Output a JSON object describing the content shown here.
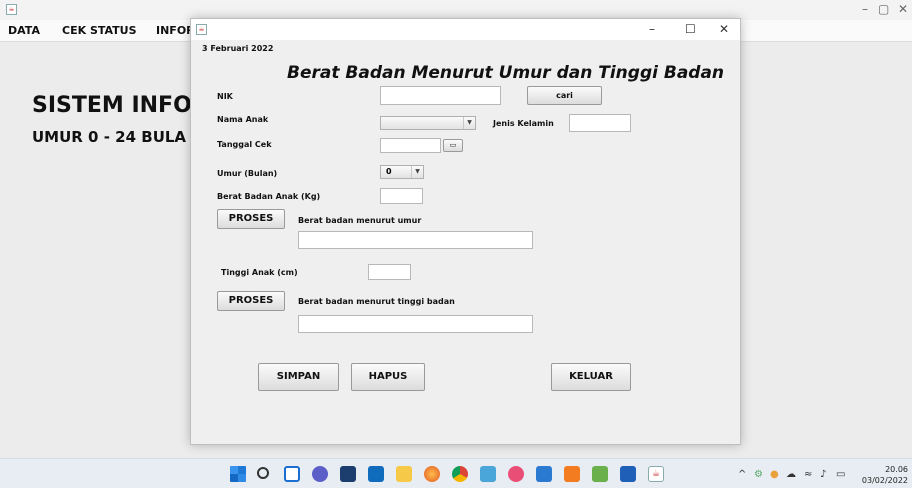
{
  "background_app": {
    "menu": [
      "DATA",
      "CEK STATUS",
      "INFOR"
    ],
    "title_line1": "SISTEM INFO",
    "title_line2": "UMUR 0 - 24 BULA",
    "window_controls": {
      "minimize": "–",
      "maximize": "▢",
      "close": "✕"
    }
  },
  "dialog": {
    "window_controls": {
      "minimize": "–",
      "maximize": "☐",
      "close": "✕"
    },
    "date": "3 Februari 2022",
    "heading": "Berat Badan Menurut Umur dan Tinggi Badan",
    "fields": {
      "nik_label": "NIK",
      "nik_value": "",
      "cari_button": "cari",
      "nama_anak_label": "Nama Anak",
      "nama_anak_value": "",
      "jenis_kelamin_label": "Jenis Kelamin",
      "jenis_kelamin_value": "",
      "tanggal_cek_label": "Tanggal Cek",
      "tanggal_cek_value": "",
      "umur_label": "Umur (Bulan)",
      "umur_value": "0",
      "berat_label": "Berat Badan Anak (Kg)",
      "berat_value": "",
      "proses1_button": "PROSES",
      "bb_umur_label": "Berat badan menurut umur",
      "bb_umur_value": "",
      "tinggi_label": "Tinggi Anak (cm)",
      "tinggi_value": "",
      "proses2_button": "PROSES",
      "bb_tinggi_label": "Berat badan menurut tinggi badan",
      "bb_tinggi_value": ""
    },
    "buttons": {
      "simpan": "SIMPAN",
      "hapus": "HAPUS",
      "keluar": "KELUAR"
    }
  },
  "taskbar": {
    "icons": [
      "windows-start-icon",
      "search-icon",
      "task-view-icon",
      "chat-icon",
      "calculator-icon",
      "mail-icon",
      "file-explorer-icon",
      "firefox-icon",
      "chrome-icon",
      "network-app-icon",
      "notification-app-icon",
      "vscode-icon",
      "xampp-icon",
      "paint-icon",
      "word-icon",
      "java-app-icon"
    ],
    "tray": [
      "^",
      "wifi",
      "sound",
      "battery"
    ],
    "time": "20.06",
    "date": "03/02/2022"
  }
}
